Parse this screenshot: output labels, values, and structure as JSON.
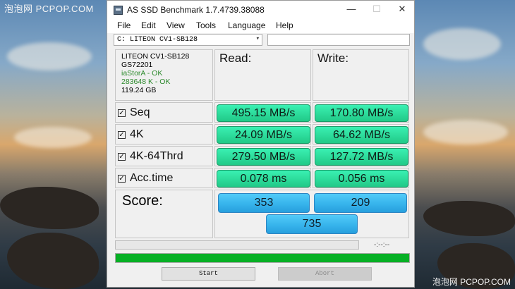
{
  "watermark": {
    "top": "泡泡网 PCPOP.COM",
    "bottom": "泡泡网 PCPOP.COM"
  },
  "window": {
    "title": "AS SSD Benchmark 1.7.4739.38088",
    "controls": {
      "minimize": "—",
      "maximize": "☐",
      "close": "✕"
    }
  },
  "menu": [
    "File",
    "Edit",
    "View",
    "Tools",
    "Language",
    "Help"
  ],
  "drive": {
    "selected": "C: LITEON CV1-SB128"
  },
  "info": {
    "model": "LITEON CV1-SB128",
    "firmware": "GS72201",
    "driver": "iaStorA - OK",
    "alignment": "283648 K - OK",
    "size": "119.24 GB"
  },
  "headers": {
    "read": "Read:",
    "write": "Write:"
  },
  "rows": [
    {
      "label": "Seq",
      "checked": true,
      "read": "495.15 MB/s",
      "write": "170.80 MB/s"
    },
    {
      "label": "4K",
      "checked": true,
      "read": "24.09 MB/s",
      "write": "64.62 MB/s"
    },
    {
      "label": "4K-64Thrd",
      "checked": true,
      "read": "279.50 MB/s",
      "write": "127.72 MB/s"
    },
    {
      "label": "Acc.time",
      "checked": true,
      "read": "0.078 ms",
      "write": "0.056 ms"
    }
  ],
  "score": {
    "label": "Score:",
    "read": "353",
    "write": "209",
    "total": "735"
  },
  "progress": {
    "time": "-:--:--",
    "overall_fraction": 1.0
  },
  "buttons": {
    "start": "Start",
    "abort": "Abort"
  },
  "colors": {
    "result_green": "#2fdf9f",
    "score_blue": "#37b4ec",
    "progress_green": "#06b025"
  },
  "icons": {
    "check": "☑",
    "dropdown": "▾"
  }
}
